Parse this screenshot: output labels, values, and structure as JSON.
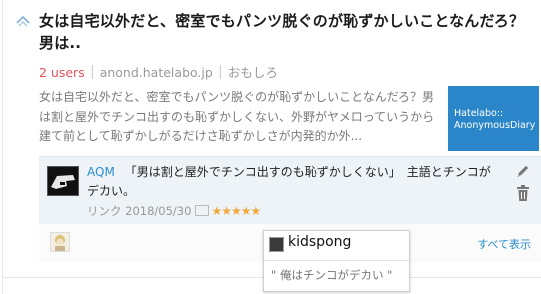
{
  "entry": {
    "title": "女は自宅以外だと、密室でもパンツ脱ぐのが恥ずかしいことなんだろ？ 男は..",
    "users": "2 users",
    "domain": "anond.hatelabo.jp",
    "category": "おもしろ",
    "summary": "女は自宅以外だと、密室でもパンツ脱ぐのが恥ずかしいことなんだろ？男は割と屋外でチンコ出すのも恥ずかしくない、外野がヤメロっていうから建て前として恥ずかしがるだけさ恥ずかしさが内発的か外...",
    "thumbnail_line1": "Hatelabo::",
    "thumbnail_line2": "AnonymousDiary"
  },
  "comment": {
    "user": "AQM",
    "text": "「男は割と屋外でチンコ出すのも恥ずかしくない」　主語とチンコがデカい。",
    "meta_prefix": "リンク 2018/05/30",
    "stars": "★★★★★"
  },
  "footer": {
    "show_all": "すべて表示"
  },
  "popup": {
    "user": "kidspong",
    "quote": "\" 俺はチンコがデカい \""
  },
  "colors": {
    "users_red": "#e4525a",
    "link_blue": "#2a8fcf",
    "thumbnail_bg": "#2b86c9",
    "star_orange": "#f2a93b"
  },
  "icons": [
    "bookmark-favicon-icon",
    "edit-pencil-icon",
    "trash-icon",
    "tag-icon",
    "star-icon"
  ]
}
